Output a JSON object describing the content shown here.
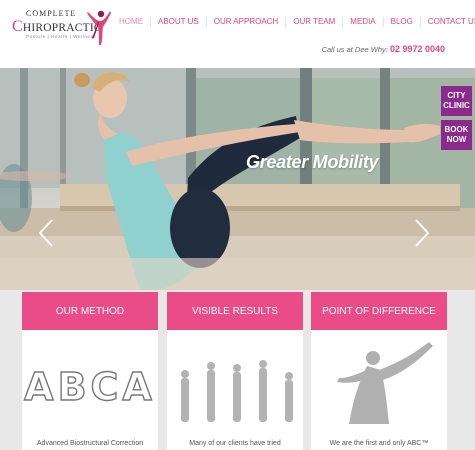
{
  "header": {
    "logo": {
      "line1": "COMPLETE",
      "line2_initial": "C",
      "line2_rest": "HIROPRACTIC",
      "tagline": "Posture  |  Health  |  Wellness"
    },
    "nav": [
      {
        "label": "HOME",
        "active": true
      },
      {
        "label": "ABOUT US",
        "active": false
      },
      {
        "label": "OUR APPROACH",
        "active": false
      },
      {
        "label": "OUR TEAM",
        "active": false
      },
      {
        "label": "MEDIA",
        "active": false
      },
      {
        "label": "BLOG",
        "active": false
      },
      {
        "label": "CONTACT US",
        "active": false
      }
    ],
    "call_text": "Call us at Dee Why:",
    "phone": "02 9972 0040"
  },
  "hero": {
    "caption": "Greater Mobility",
    "side_tabs": {
      "city_line1": "CITY",
      "city_line2": "CLINIC",
      "book_line1": "BOOK",
      "book_line2": "NOW"
    }
  },
  "features": [
    {
      "title": "OUR METHOD",
      "art_text": "ABCA",
      "text": "Advanced Biostructural Correction"
    },
    {
      "title": "VISIBLE RESULTS",
      "text": "Many of our clients have tried"
    },
    {
      "title": "POINT OF DIFFERENCE",
      "text": "We are the first and only ABC™"
    }
  ],
  "colors": {
    "brand_pink": "#e94c86",
    "nav_pink": "#e0457b",
    "side_tab_purple": "#8a2a8f"
  }
}
